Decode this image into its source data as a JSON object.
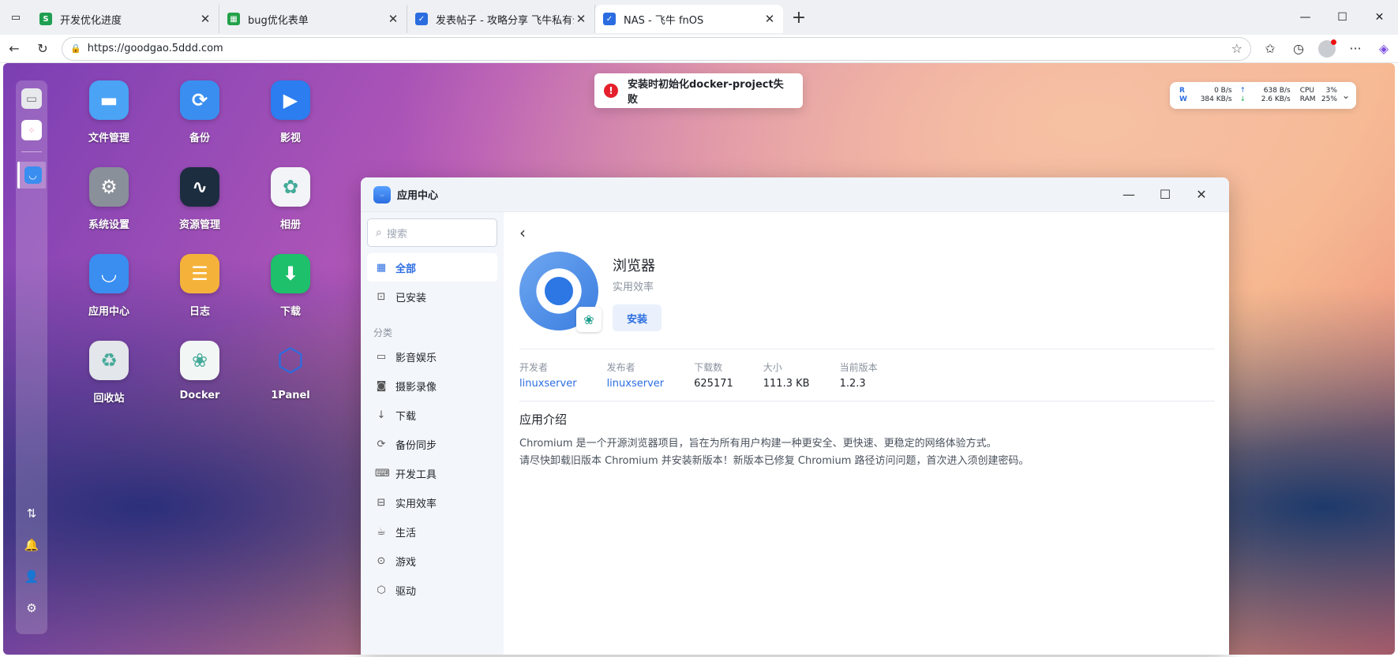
{
  "browser": {
    "tabs": [
      {
        "title": "开发优化进度",
        "color": "#1e9f52",
        "glyph": "S"
      },
      {
        "title": "bug优化表单",
        "color": "#23a14a",
        "glyph": "▦"
      },
      {
        "title": "发表帖子 - 攻略分享 飞牛私有云论坛",
        "color": "#2b6de0",
        "glyph": "✓"
      },
      {
        "title": "NAS - 飞牛 fnOS",
        "color": "#2b6de0",
        "glyph": "✓"
      }
    ],
    "url": "https://goodgao.5ddd.com"
  },
  "desktop_icons": [
    {
      "label": "文件管理",
      "color": "#4aa3f5",
      "glyph": "▬"
    },
    {
      "label": "备份",
      "color": "#3a8ef0",
      "glyph": "⟳"
    },
    {
      "label": "影视",
      "color": "#2b7df0",
      "glyph": "▶"
    },
    {
      "label": "系统设置",
      "color": "#8a9099",
      "glyph": "⚙"
    },
    {
      "label": "资源管理",
      "color": "#1c2d40",
      "glyph": "∿"
    },
    {
      "label": "相册",
      "color": "#f2f4f7",
      "glyph": "✿"
    },
    {
      "label": "应用中心",
      "color": "#3a8ef0",
      "glyph": "◡"
    },
    {
      "label": "日志",
      "color": "#f5b23a",
      "glyph": "☰"
    },
    {
      "label": "下载",
      "color": "#1ec06b",
      "glyph": "⬇"
    },
    {
      "label": "回收站",
      "color": "#e3e6ea",
      "glyph": "♻"
    },
    {
      "label": "Docker",
      "color": "#f2f6f5",
      "glyph": "❀"
    },
    {
      "label": "1Panel",
      "color": "transparent",
      "glyph": "⬡"
    }
  ],
  "toast": {
    "message": "安装时初始化docker-project失败"
  },
  "monitor": {
    "r_label": "R",
    "w_label": "W",
    "r_val": "0 B/s",
    "w_val": "384 KB/s",
    "up_val": "638 B/s",
    "dn_val": "2.6 KB/s",
    "cpu_label": "CPU",
    "ram_label": "RAM",
    "cpu_val": "3%",
    "ram_val": "25%"
  },
  "window": {
    "title": "应用中心",
    "search_placeholder": "搜索",
    "nav": [
      {
        "label": "全部",
        "icon": "▦"
      },
      {
        "label": "已安装",
        "icon": "⊡"
      }
    ],
    "category_title": "分类",
    "categories": [
      {
        "label": "影音娱乐",
        "icon": "▭"
      },
      {
        "label": "摄影录像",
        "icon": "◙"
      },
      {
        "label": "下载",
        "icon": "↓"
      },
      {
        "label": "备份同步",
        "icon": "⟳"
      },
      {
        "label": "开发工具",
        "icon": "⌨"
      },
      {
        "label": "实用效率",
        "icon": "⊟"
      },
      {
        "label": "生活",
        "icon": "☕"
      },
      {
        "label": "游戏",
        "icon": "⊙"
      },
      {
        "label": "驱动",
        "icon": "⬡"
      }
    ],
    "app": {
      "name": "浏览器",
      "category": "实用效率",
      "install_label": "安装",
      "meta": [
        {
          "key": "开发者",
          "value": "linuxserver",
          "link": true
        },
        {
          "key": "发布者",
          "value": "linuxserver",
          "link": true
        },
        {
          "key": "下载数",
          "value": "625171",
          "link": false
        },
        {
          "key": "大小",
          "value": "111.3 KB",
          "link": false
        },
        {
          "key": "当前版本",
          "value": "1.2.3",
          "link": false
        }
      ],
      "intro_title": "应用介绍",
      "intro_lines": [
        "Chromium 是一个开源浏览器项目，旨在为所有用户构建一种更安全、更快速、更稳定的网络体验方式。",
        "请尽快卸载旧版本 Chromium 并安装新版本！新版本已修复 Chromium 路径访问问题，首次进入须创建密码。"
      ]
    }
  }
}
